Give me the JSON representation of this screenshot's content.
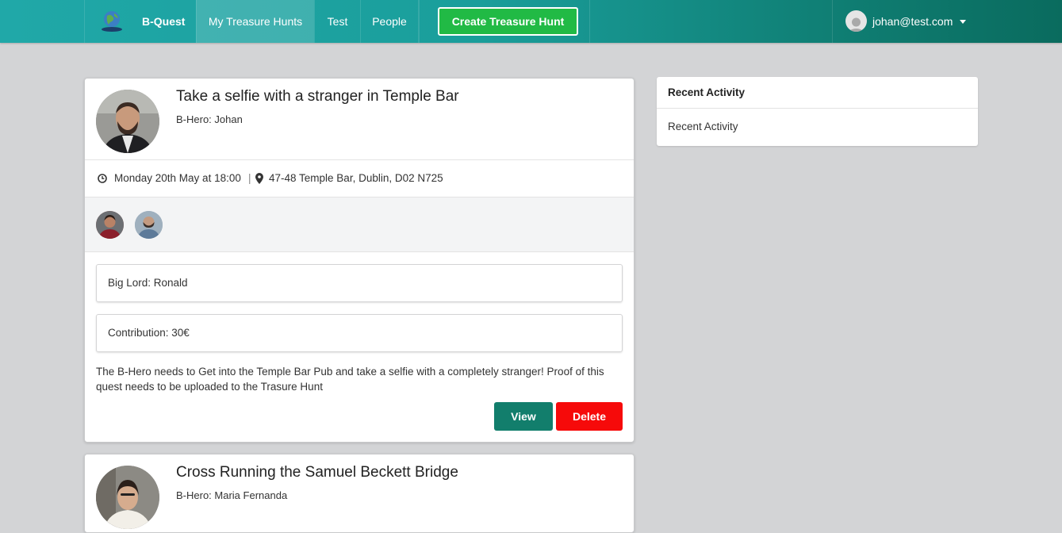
{
  "nav": {
    "brand": "B-Quest",
    "logo_icon": "globe-logo-icon",
    "items": [
      {
        "label": "My Treasure Hunts",
        "active": true
      },
      {
        "label": "Test",
        "active": false
      },
      {
        "label": "People",
        "active": false
      }
    ],
    "create_button": "Create Treasure Hunt",
    "user_email": "johan@test.com",
    "user_icon": "user-avatar-icon",
    "dropdown_icon": "caret-down-icon"
  },
  "colors": {
    "nav_gradient_start": "#20a8a8",
    "nav_gradient_end": "#0a6b5e",
    "create_button": "#21ba45",
    "view_button": "#127e6c",
    "delete_button": "#f60a0a",
    "page_background": "#d3d4d6"
  },
  "hunts": [
    {
      "title": "Take a selfie with a stranger in Temple Bar",
      "hero": "B-Hero: Johan",
      "datetime": "Monday 20th May at 18:00",
      "separator": "|",
      "location": "47-48 Temple Bar, Dublin, D02 N725",
      "clock_icon": "clock-icon",
      "pin_icon": "map-pin-icon",
      "participants_count": 2,
      "big_lord": "Big Lord: Ronald",
      "contribution": "Contribution: 30€",
      "description": "The B-Hero needs to Get into the Temple Bar Pub and take a selfie with a completely stranger! Proof of this quest needs to be uploaded to the Trasure Hunt",
      "view_label": "View",
      "delete_label": "Delete"
    },
    {
      "title": "Cross Running the Samuel Beckett Bridge",
      "hero": "B-Hero: Maria Fernanda"
    }
  ],
  "sidebar": {
    "header": "Recent Activity",
    "body": "Recent Activity"
  }
}
